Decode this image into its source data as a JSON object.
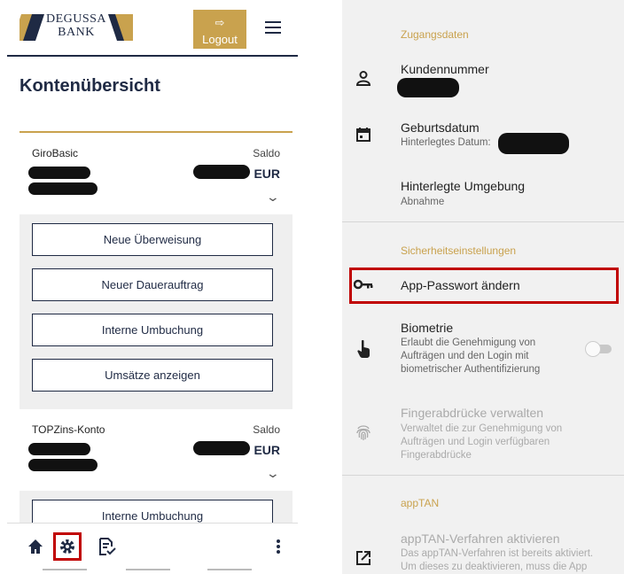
{
  "left": {
    "logo_line1": "DEGUSSA",
    "logo_line2": "BANK",
    "logout_label": "Logout",
    "page_title": "Kontenübersicht",
    "accounts": [
      {
        "name": "GiroBasic",
        "saldo_label": "Saldo",
        "currency": "EUR"
      },
      {
        "name": "TOPZins-Konto",
        "saldo_label": "Saldo",
        "currency": "EUR"
      }
    ],
    "giro_actions": [
      "Neue Überweisung",
      "Neuer Dauerauftrag",
      "Interne Umbuchung",
      "Umsätze anzeigen"
    ],
    "topzins_actions": [
      "Interne Umbuchung"
    ],
    "bottom_nav": [
      "home-icon",
      "gear-icon",
      "document-check-icon",
      "more-vertical-icon"
    ]
  },
  "right": {
    "section_access": "Zugangsdaten",
    "customer_number": "Kundennummer",
    "birthdate": "Geburtsdatum",
    "birthdate_sub": "Hinterlegtes Datum:",
    "environment": "Hinterlegte Umgebung",
    "environment_sub": "Abnahme",
    "section_security": "Sicherheitseinstellungen",
    "change_password": "App-Passwort ändern",
    "biometrics": "Biometrie",
    "biometrics_sub1": "Erlaubt die Genehmigung von",
    "biometrics_sub2": "Aufträgen und den Login mit",
    "biometrics_sub3": "biometrischer Authentifizierung",
    "biometrics_enabled": false,
    "fingerprints": "Fingerabdrücke verwalten",
    "fingerprints_sub1": "Verwaltet die zur Genehmigung von",
    "fingerprints_sub2": "Aufträgen und Login verfügbaren",
    "fingerprints_sub3": "Fingerabdrücke",
    "section_apptan": "appTAN",
    "apptan_activate": "appTAN-Verfahren aktivieren",
    "apptan_sub1": "Das appTAN-Verfahren ist bereits aktiviert.",
    "apptan_sub2": "Um dieses zu deaktivieren, muss die App"
  },
  "colors": {
    "navy": "#1f2a44",
    "gold": "#c9a24e",
    "highlight": "#c00000"
  }
}
